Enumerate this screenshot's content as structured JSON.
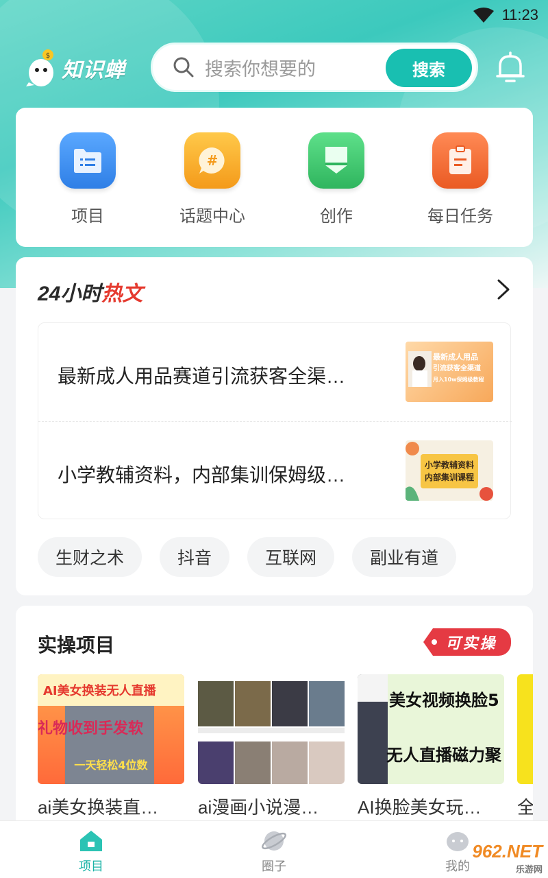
{
  "status_bar": {
    "time": "11:23"
  },
  "header": {
    "app_name": "知识蝉",
    "search_placeholder": "搜索你想要的",
    "search_button": "搜索"
  },
  "quick_links": [
    {
      "label": "项目",
      "icon": "folder-list-icon",
      "color": "#3a8df0"
    },
    {
      "label": "话题中心",
      "icon": "hashtag-chat-icon",
      "color": "#f9a825"
    },
    {
      "label": "创作",
      "icon": "bookmark-pen-icon",
      "color": "#3cc36b"
    },
    {
      "label": "每日任务",
      "icon": "clipboard-task-icon",
      "color": "#f0672b"
    }
  ],
  "hot_section": {
    "title_prefix": "24小时",
    "title_highlight": "热文",
    "articles": [
      {
        "title": "最新成人用品赛道引流获客全渠…",
        "thumb_text": [
          "最新成人用品",
          "引流获客全渠道",
          "月入10w保姆级教程"
        ]
      },
      {
        "title": "小学教辅资料，内部集训保姆级…",
        "thumb_text": [
          "小学教辅资料",
          "内部集训课程"
        ]
      }
    ],
    "tags": [
      "生财之术",
      "抖音",
      "互联网",
      "副业有道"
    ]
  },
  "projects_section": {
    "title": "实操项目",
    "badge": "可实操",
    "items": [
      {
        "name": "ai美女换装直…",
        "thumb_text": [
          "AI美女换装无人直播",
          "礼物收到手发软",
          "一天轻松4位数"
        ]
      },
      {
        "name": "ai漫画小说漫…",
        "thumb_text": []
      },
      {
        "name": "AI换脸美女玩…",
        "thumb_text": [
          "美女视频换脸5",
          "无人直播磁力聚"
        ]
      },
      {
        "name": "全",
        "thumb_text": []
      }
    ]
  },
  "bottom_nav": [
    {
      "label": "项目",
      "active": true
    },
    {
      "label": "圈子",
      "active": false
    },
    {
      "label": "我的",
      "active": false
    }
  ],
  "watermark": {
    "main": "962.NET",
    "sub": "乐游网"
  },
  "colors": {
    "accent": "#19bfb1",
    "hot_red": "#e53a2f",
    "badge_red": "#e53a43"
  }
}
